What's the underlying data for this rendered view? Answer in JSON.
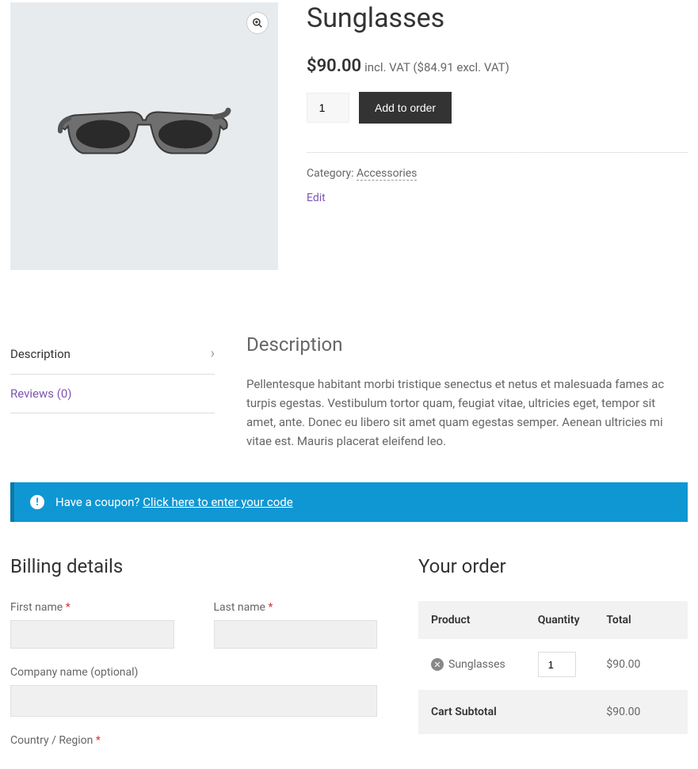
{
  "product": {
    "title": "Sunglasses",
    "currency": "$",
    "price": "90.00",
    "incl_text": "incl. VAT",
    "excl_price": "$84.91",
    "excl_text": "excl. VAT",
    "quantity": "1",
    "add_button": "Add to order",
    "category_label": "Category:",
    "category_link": "Accessories",
    "edit_link": "Edit"
  },
  "tabs": {
    "description_tab": "Description",
    "reviews_tab": "Reviews (0)",
    "panel_heading": "Description",
    "panel_text": "Pellentesque habitant morbi tristique senectus et netus et malesuada fames ac turpis egestas. Vestibulum tortor quam, feugiat vitae, ultricies eget, tempor sit amet, ante. Donec eu libero sit amet quam egestas semper. Aenean ultricies mi vitae est. Mauris placerat eleifend leo."
  },
  "coupon": {
    "text": "Have a coupon?",
    "link": "Click here to enter your code"
  },
  "billing": {
    "heading": "Billing details",
    "first_name": "First name",
    "last_name": "Last name",
    "company": "Company name (optional)",
    "country": "Country / Region"
  },
  "order": {
    "heading": "Your order",
    "col_product": "Product",
    "col_quantity": "Quantity",
    "col_total": "Total",
    "item_name": "Sunglasses",
    "item_qty": "1",
    "item_total": "$90.00",
    "subtotal_label": "Cart Subtotal",
    "subtotal_value": "$90.00"
  }
}
